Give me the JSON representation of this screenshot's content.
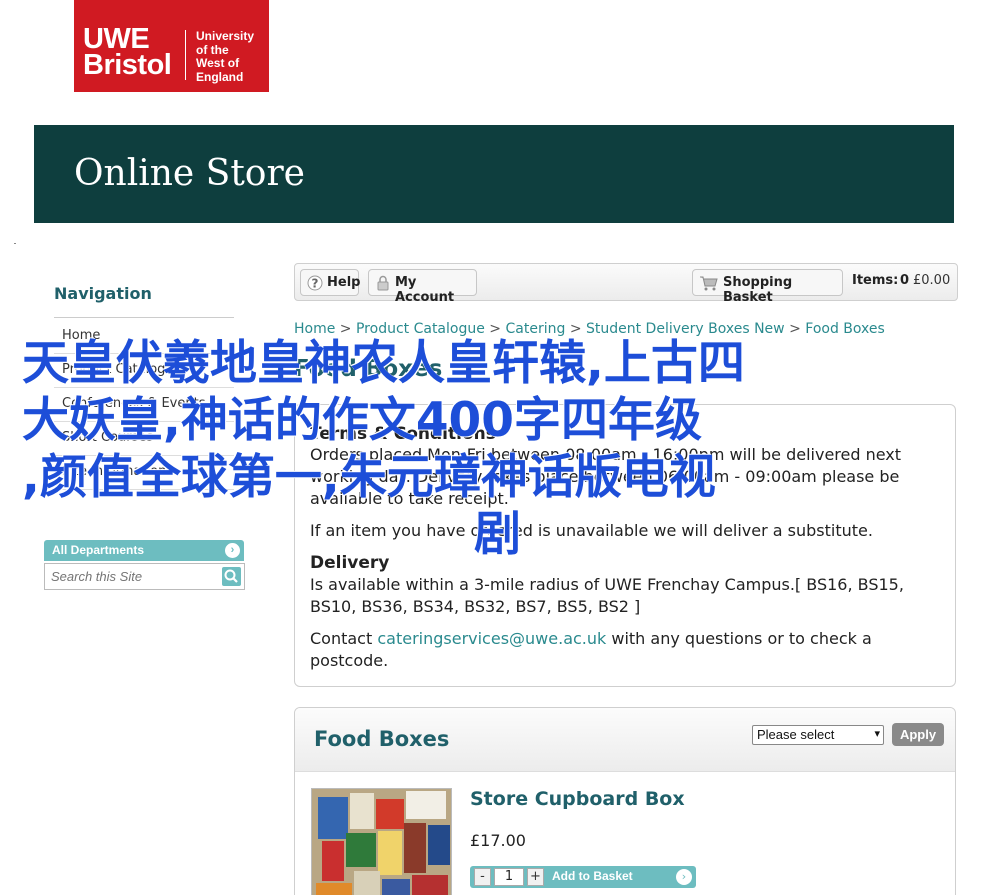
{
  "logo": {
    "line1": "UWE",
    "line2": "Bristol",
    "uni1": "University",
    "uni2": "of the",
    "uni3": "West of",
    "uni4": "England"
  },
  "banner": {
    "title": "Online Store"
  },
  "sidebar": {
    "title": "Navigation",
    "items": [
      {
        "label": "Home"
      },
      {
        "label": "Product Catalogue"
      },
      {
        "label": "Conferences & Events"
      },
      {
        "label": "Short Courses"
      },
      {
        "label": "Site Information"
      }
    ],
    "departments_label": "All Departments",
    "search_placeholder": "Search this Site"
  },
  "toolbar": {
    "help": "Help",
    "account": "My Account",
    "basket": "Shopping Basket",
    "items_label": "Items:",
    "items_count": "0",
    "items_total": "£0.00"
  },
  "breadcrumb": {
    "items": [
      "Home",
      "Product Catalogue",
      "Catering",
      "Student Delivery Boxes New",
      "Food Boxes"
    ],
    "separator": ">"
  },
  "page_title": "Food Boxes",
  "terms": {
    "heading": "Terms & Conditions",
    "line1": "Orders placed Mon-Fri between 08:00am - 16:00pm will be delivered next",
    "line2": "working day. Delivery takes place between 06:00am - 09:00am please be",
    "line3": "available to take receipt.",
    "substitute": "If an item you have ordered is unavailable we will deliver a substitute.",
    "delivery_heading": "Delivery",
    "delivery1": "Is available within a 3-mile radius of UWE Frenchay Campus.[ BS16, BS15,",
    "delivery2": "BS10, BS36, BS34, BS32, BS7, BS5, BS2 ]",
    "contact_pre": "Contact",
    "contact_email": "cateringservices@uwe.ac.uk",
    "contact_post": "with any questions or to check a",
    "contact_line2": "postcode."
  },
  "food_boxes": {
    "title": "Food Boxes",
    "select_value": "Please select",
    "apply": "Apply",
    "product": {
      "name": "Store Cupboard Box",
      "price": "£17.00",
      "quantity": "1",
      "minus": "-",
      "plus": "+",
      "add_label": "Add to Basket"
    }
  },
  "overlay": {
    "line1": "天皇伏羲地皇神农人皇轩辕,上古四",
    "line2": "大妖皇,神话的作文400字四年级",
    "line3": ",颜值全球第一,朱元璋神话版电视",
    "line4": "剧"
  },
  "colors": {
    "brand_red": "#d01a22",
    "banner": "#0e3e3e",
    "teal_text": "#20606a",
    "link": "#2a8a8e",
    "accent": "#6dbdc0",
    "overlay": "#1d4ed8"
  }
}
